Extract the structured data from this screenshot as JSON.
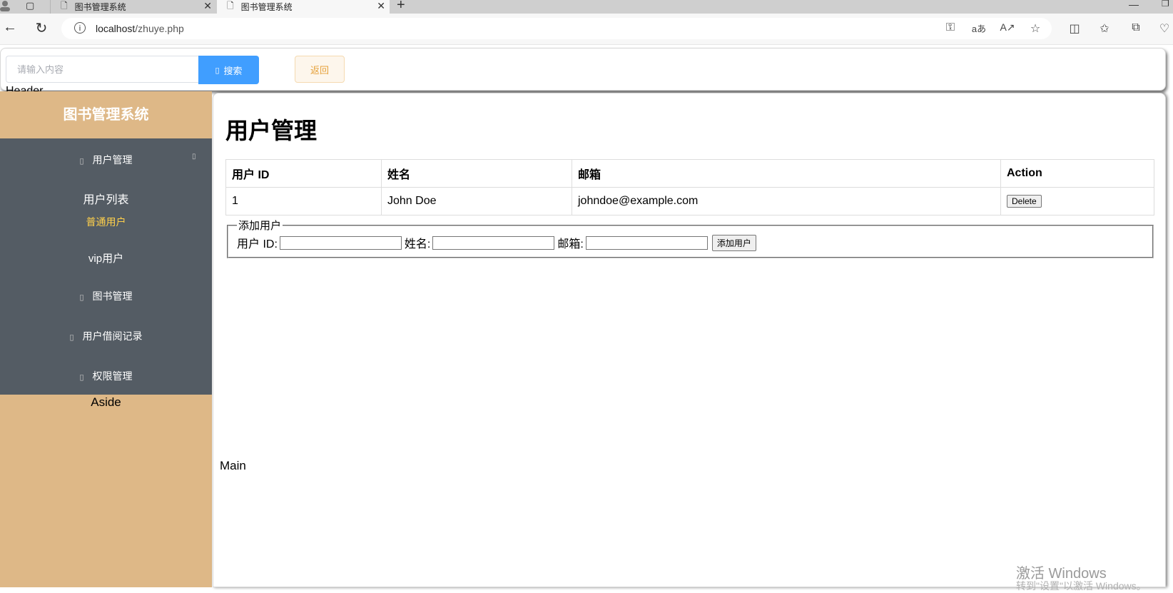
{
  "browser": {
    "tabs": [
      {
        "title": "图书管理系统",
        "active": false
      },
      {
        "title": "图书管理系统",
        "active": true
      }
    ],
    "new_tab": "+",
    "address": {
      "host": "localhost",
      "path": "/zhuye.php"
    },
    "icons": [
      "back-arrow-icon",
      "refresh-icon",
      "info-icon",
      "key-icon",
      "translate-icon",
      "read-aloud-icon",
      "favorite-star-icon",
      "split-screen-icon",
      "favorites-icon",
      "collections-icon",
      "extensions-icon"
    ]
  },
  "header": {
    "search_placeholder": "请输入内容",
    "search_label": "搜索",
    "back_label": "返回",
    "region_label": "Header"
  },
  "aside": {
    "brand": "图书管理系统",
    "menu": {
      "user_mgmt": "用户管理",
      "user_list": "用户列表",
      "normal_user": "普通用户",
      "vip_user": "vip用户",
      "book_mgmt": "图书管理",
      "borrow_records": "用户借阅记录",
      "permission_mgmt": "权限管理"
    },
    "region_label": "Aside",
    "active_color": "#ffd04b",
    "menu_bg": "#545c64",
    "aside_bg": "#deb887"
  },
  "main": {
    "title": "用户管理",
    "table": {
      "headers": [
        "用户 ID",
        "姓名",
        "邮箱",
        "Action"
      ],
      "rows": [
        {
          "id": "1",
          "name": "John Doe",
          "email": "johndoe@example.com",
          "action": "Delete"
        }
      ]
    },
    "form": {
      "legend": "添加用户",
      "id_label": "用户 ID:",
      "name_label": "姓名:",
      "email_label": "邮箱:",
      "submit_label": "添加用户"
    },
    "region_label": "Main"
  },
  "watermark": {
    "line1": "激活 Windows",
    "line2": "转到\"设置\"以激活 Windows。"
  }
}
